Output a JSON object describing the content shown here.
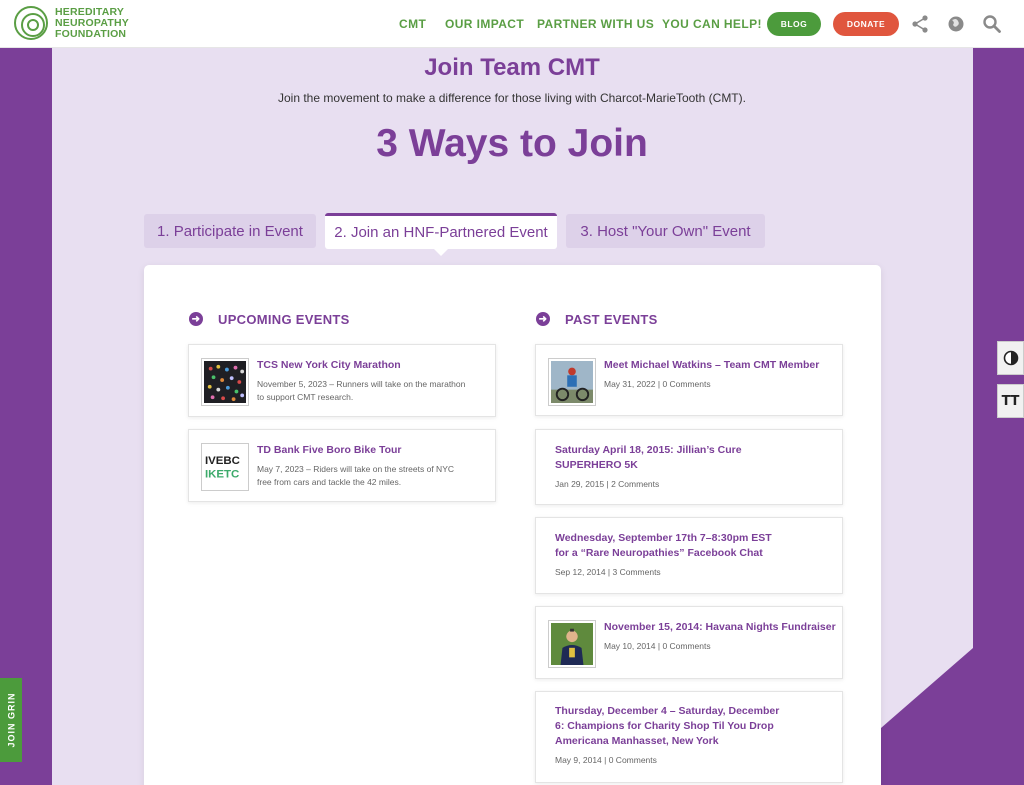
{
  "header": {
    "logo_lines": [
      "HEREDITARY",
      "NEUROPATHY",
      "FOUNDATION"
    ],
    "nav": [
      "CMT",
      "OUR IMPACT",
      "PARTNER WITH US",
      "YOU CAN HELP!"
    ],
    "blog_label": "BLOG",
    "donate_label": "DONATE"
  },
  "hero": {
    "title": "Join Team CMT",
    "subtitle": "Join the movement to make a difference for those living with Charcot-MarieTooth (CMT).",
    "ways_title": "3 Ways to Join"
  },
  "tabs": [
    {
      "label": "1. Participate in Event",
      "active": false
    },
    {
      "label": "2. Join an HNF-Partnered Event",
      "active": true
    },
    {
      "label": "3. Host \"Your Own\" Event",
      "active": false
    }
  ],
  "upcoming": {
    "heading": "UPCOMING EVENTS",
    "items": [
      {
        "title": "TCS New York City Marathon",
        "desc_line1": "November 5, 2023 – Runners will take on the marathon",
        "desc_line2": "to support CMT research.",
        "thumb": "marathon-crowd-photo"
      },
      {
        "title": "TD Bank Five Boro Bike Tour",
        "desc_line1": "May 7, 2023 – Riders will take on the streets of NYC",
        "desc_line2": "free from cars and tackle the 42 miles.",
        "thumb": "bike-tour-logo",
        "thumb_text_line1": "IVEBC",
        "thumb_text_line2": "IKETC"
      }
    ]
  },
  "past": {
    "heading": "PAST EVENTS",
    "items": [
      {
        "title_lines": [
          "Meet Michael Watkins – Team CMT Member"
        ],
        "meta": "May 31, 2022 | 0 Comments",
        "thumb": "cyclist-photo"
      },
      {
        "title_lines": [
          "Saturday April 18, 2015: Jillian’s Cure",
          "SUPERHERO 5K"
        ],
        "meta": "Jan 29, 2015 | 2 Comments"
      },
      {
        "title_lines": [
          "Wednesday, September 17th 7–8:30pm EST",
          "for a “Rare Neuropathies” Facebook Chat"
        ],
        "meta": "Sep 12, 2014 | 3 Comments"
      },
      {
        "title_lines": [
          "November 15, 2014: Havana Nights Fundraiser"
        ],
        "meta": "May 10, 2014 | 0 Comments",
        "thumb": "person-portrait-photo"
      },
      {
        "title_lines": [
          "Thursday, December 4 – Saturday, December",
          "6: Champions for Charity Shop Til You Drop",
          "Americana Manhasset, New York"
        ],
        "meta": "May 9, 2014 | 0 Comments"
      }
    ]
  },
  "widgets": {
    "join_grin": "JOIN GRIN",
    "contrast_icon": "contrast-icon",
    "text_size_icon": "text-size-icon",
    "text_size_glyph": "TТ"
  },
  "colors": {
    "brand_purple": "#7b3f98",
    "brand_green": "#5a9e44",
    "donate_orange": "#e0563e",
    "lavender_bg": "#e8dff1"
  }
}
